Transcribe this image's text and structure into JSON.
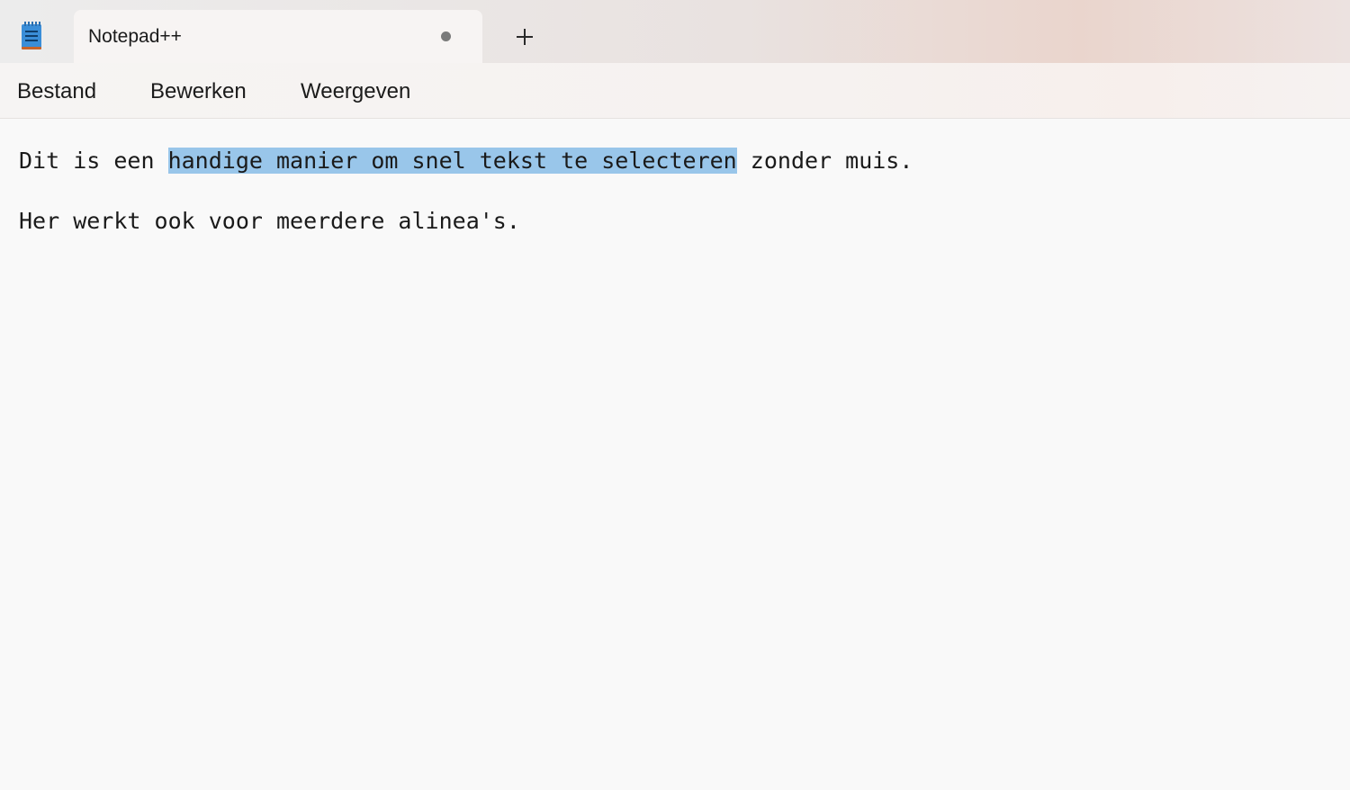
{
  "window": {
    "tab_title": "Notepad++",
    "new_tab_label": "+"
  },
  "menu": {
    "items": [
      "Bestand",
      "Bewerken",
      "Weergeven"
    ]
  },
  "editor": {
    "line1_before": "Dit is een ",
    "line1_selected": "handige manier om snel tekst te selecteren",
    "line1_after": " zonder muis.",
    "line2": "Her werkt ook voor meerdere alinea's."
  },
  "colors": {
    "selection": "#99c6ea",
    "icon_blue": "#3a8ed8",
    "icon_accent": "#c8642a"
  }
}
